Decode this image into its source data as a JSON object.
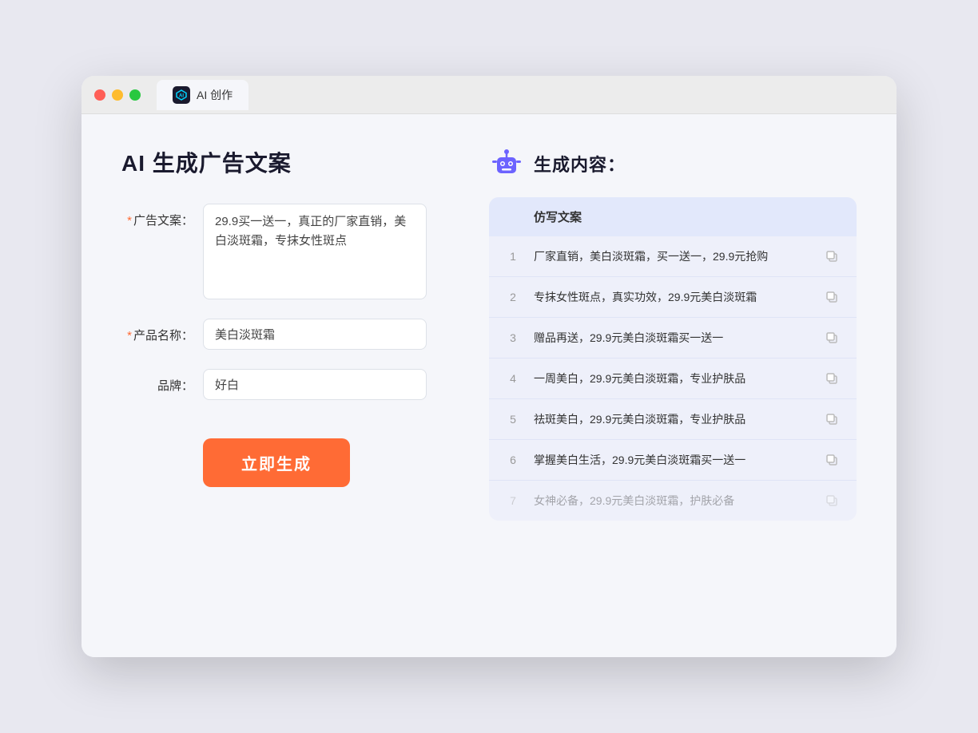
{
  "browser": {
    "tab_title": "AI 创作",
    "traffic_lights": [
      "red",
      "yellow",
      "green"
    ]
  },
  "left_panel": {
    "title": "AI 生成广告文案",
    "form": {
      "ad_copy_label": "广告文案：",
      "ad_copy_required": "*",
      "ad_copy_value": "29.9买一送一，真正的厂家直销，美白淡斑霜，专抹女性斑点",
      "product_name_label": "产品名称：",
      "product_name_required": "*",
      "product_name_value": "美白淡斑霜",
      "brand_label": "品牌：",
      "brand_value": "好白",
      "generate_btn": "立即生成"
    }
  },
  "right_panel": {
    "header": "生成内容：",
    "results_header": "仿写文案",
    "results": [
      {
        "num": "1",
        "text": "厂家直销，美白淡斑霜，买一送一，29.9元抢购",
        "dimmed": false
      },
      {
        "num": "2",
        "text": "专抹女性斑点，真实功效，29.9元美白淡斑霜",
        "dimmed": false
      },
      {
        "num": "3",
        "text": "赠品再送，29.9元美白淡斑霜买一送一",
        "dimmed": false
      },
      {
        "num": "4",
        "text": "一周美白，29.9元美白淡斑霜，专业护肤品",
        "dimmed": false
      },
      {
        "num": "5",
        "text": "祛斑美白，29.9元美白淡斑霜，专业护肤品",
        "dimmed": false
      },
      {
        "num": "6",
        "text": "掌握美白生活，29.9元美白淡斑霜买一送一",
        "dimmed": false
      },
      {
        "num": "7",
        "text": "女神必备，29.9元美白淡斑霜，护肤必备",
        "dimmed": true
      }
    ]
  }
}
